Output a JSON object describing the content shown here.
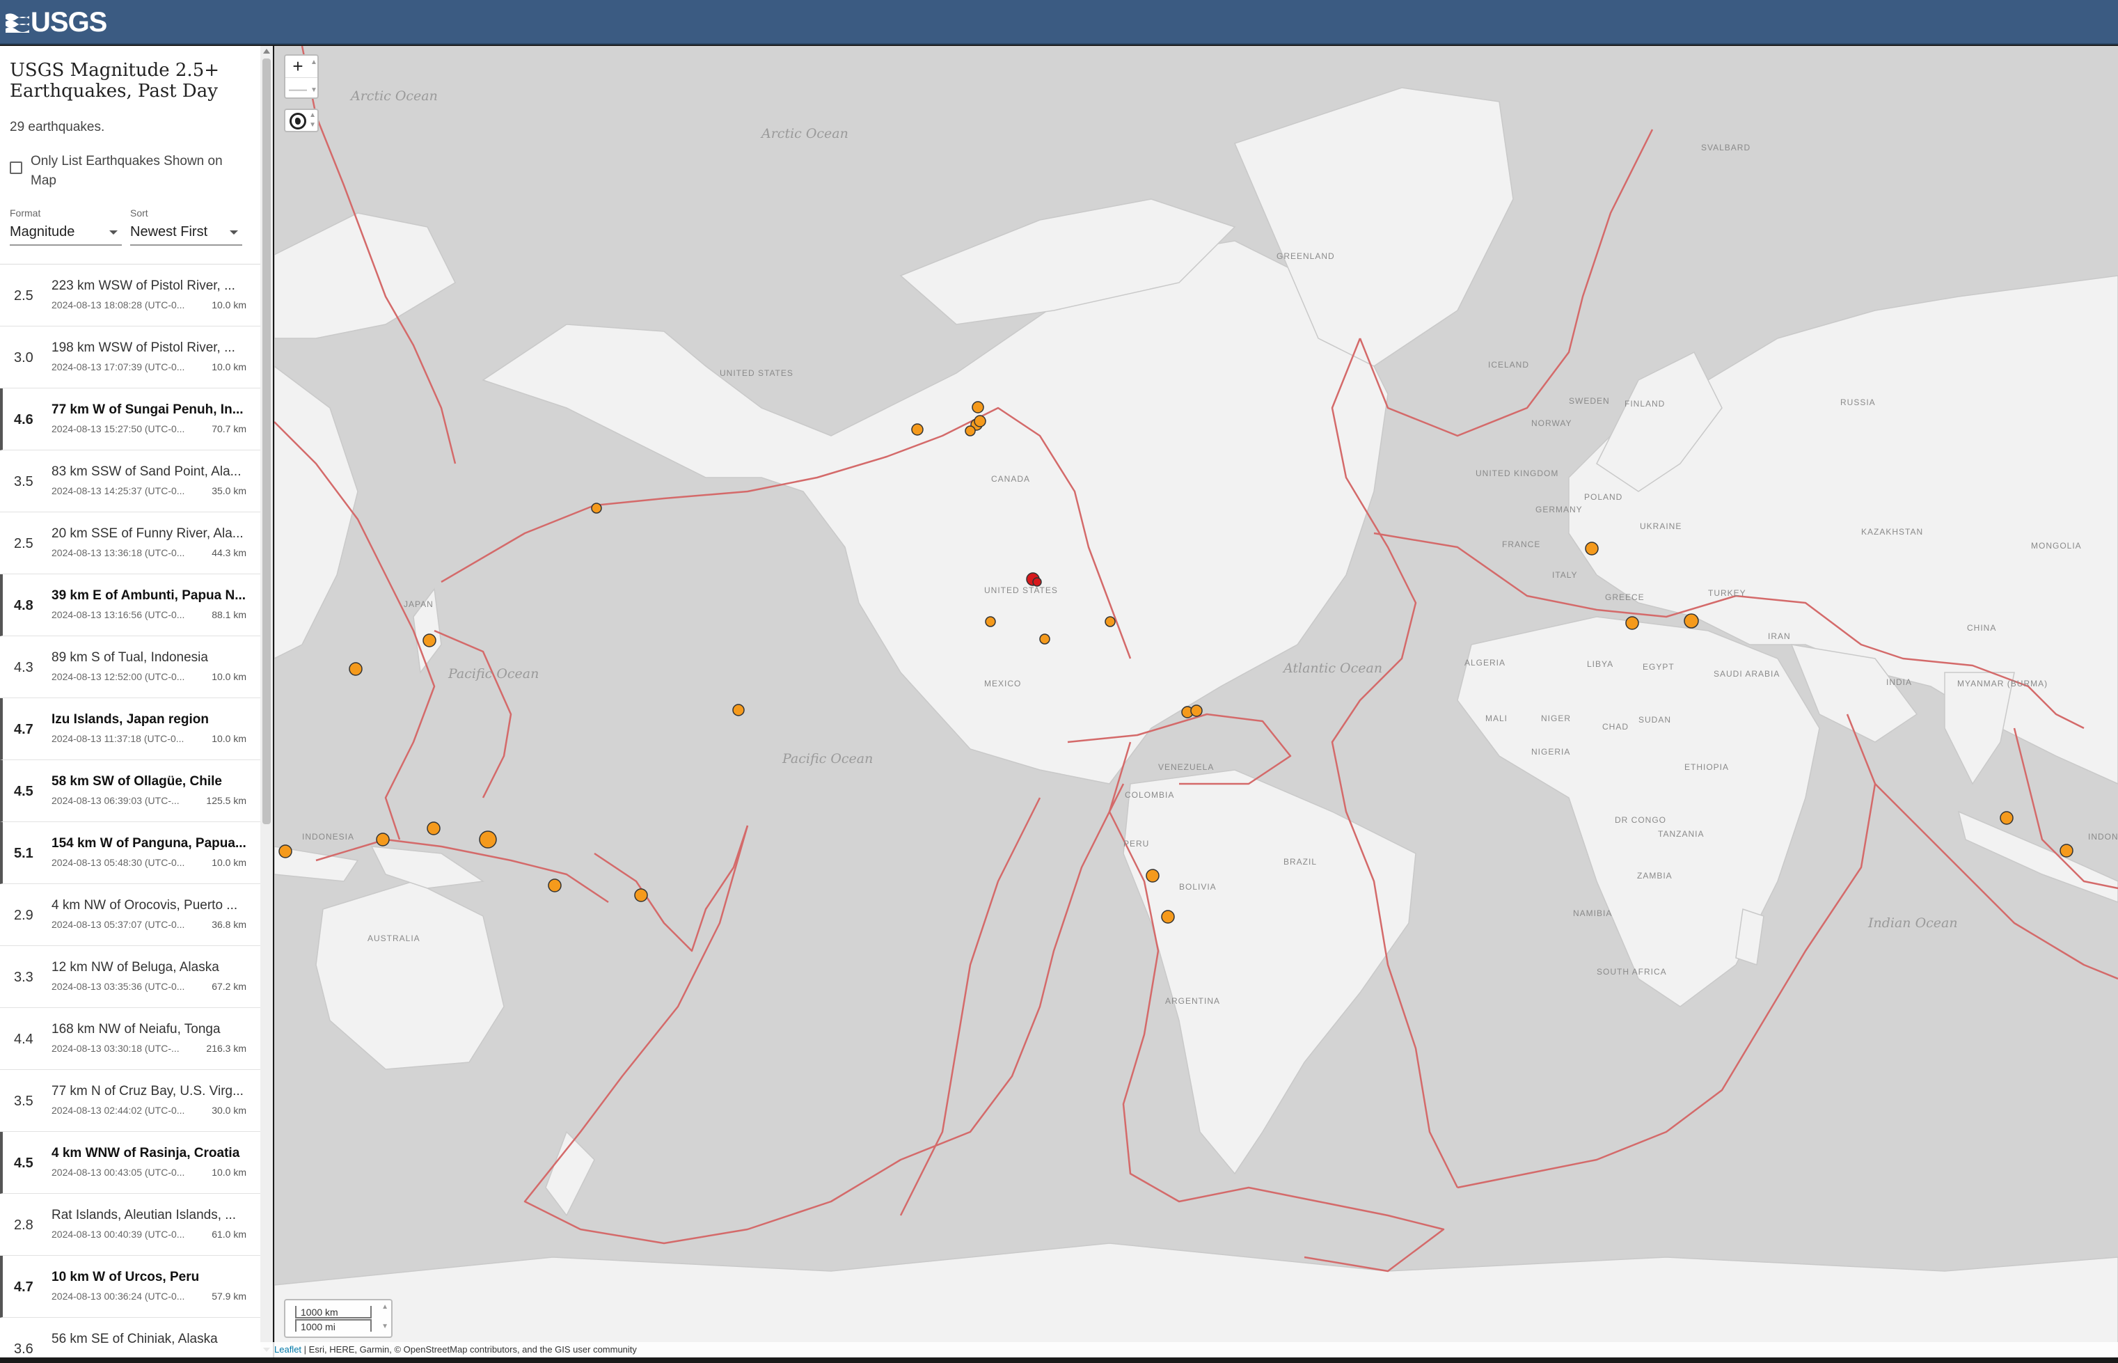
{
  "header": {
    "logo_text": "USGS"
  },
  "sidebar": {
    "title": "USGS Magnitude 2.5+ Earthquakes, Past Day",
    "count_text": "29 earthquakes.",
    "only_list_label": "Only List Earthquakes Shown on Map",
    "format": {
      "label": "Format",
      "value": "Magnitude"
    },
    "sort": {
      "label": "Sort",
      "value": "Newest First"
    }
  },
  "earthquakes": [
    {
      "mag": "2.5",
      "place": "223 km WSW of Pistol River, ...",
      "time": "2024-08-13 18:08:28 (UTC-0...",
      "depth": "10.0 km",
      "bold": false
    },
    {
      "mag": "3.0",
      "place": "198 km WSW of Pistol River, ...",
      "time": "2024-08-13 17:07:39 (UTC-0...",
      "depth": "10.0 km",
      "bold": false
    },
    {
      "mag": "4.6",
      "place": "77 km W of Sungai Penuh, In...",
      "time": "2024-08-13 15:27:50 (UTC-0...",
      "depth": "70.7 km",
      "bold": true
    },
    {
      "mag": "3.5",
      "place": "83 km SSW of Sand Point, Ala...",
      "time": "2024-08-13 14:25:37 (UTC-0...",
      "depth": "35.0 km",
      "bold": false
    },
    {
      "mag": "2.5",
      "place": "20 km SSE of Funny River, Ala...",
      "time": "2024-08-13 13:36:18 (UTC-0...",
      "depth": "44.3 km",
      "bold": false
    },
    {
      "mag": "4.8",
      "place": "39 km E of Ambunti, Papua N...",
      "time": "2024-08-13 13:16:56 (UTC-0...",
      "depth": "88.1 km",
      "bold": true
    },
    {
      "mag": "4.3",
      "place": "89 km S of Tual, Indonesia",
      "time": "2024-08-13 12:52:00 (UTC-0...",
      "depth": "10.0 km",
      "bold": false
    },
    {
      "mag": "4.7",
      "place": "Izu Islands, Japan region",
      "time": "2024-08-13 11:37:18 (UTC-0...",
      "depth": "10.0 km",
      "bold": true
    },
    {
      "mag": "4.5",
      "place": "58 km SW of Ollagüe, Chile",
      "time": "2024-08-13 06:39:03 (UTC-...",
      "depth": "125.5 km",
      "bold": true
    },
    {
      "mag": "5.1",
      "place": "154 km W of Panguna, Papua...",
      "time": "2024-08-13 05:48:30 (UTC-0...",
      "depth": "10.0 km",
      "bold": true
    },
    {
      "mag": "2.9",
      "place": "4 km NW of Orocovis, Puerto ...",
      "time": "2024-08-13 05:37:07 (UTC-0...",
      "depth": "36.8 km",
      "bold": false
    },
    {
      "mag": "3.3",
      "place": "12 km NW of Beluga, Alaska",
      "time": "2024-08-13 03:35:36 (UTC-0...",
      "depth": "67.2 km",
      "bold": false
    },
    {
      "mag": "4.4",
      "place": "168 km NW of Neiafu, Tonga",
      "time": "2024-08-13 03:30:18 (UTC-...",
      "depth": "216.3 km",
      "bold": false
    },
    {
      "mag": "3.5",
      "place": "77 km N of Cruz Bay, U.S. Virg...",
      "time": "2024-08-13 02:44:02 (UTC-0...",
      "depth": "30.0 km",
      "bold": false
    },
    {
      "mag": "4.5",
      "place": "4 km WNW of Rasinja, Croatia",
      "time": "2024-08-13 00:43:05 (UTC-0...",
      "depth": "10.0 km",
      "bold": true
    },
    {
      "mag": "2.8",
      "place": "Rat Islands, Aleutian Islands, ...",
      "time": "2024-08-13 00:40:39 (UTC-0...",
      "depth": "61.0 km",
      "bold": false
    },
    {
      "mag": "4.7",
      "place": "10 km W of Urcos, Peru",
      "time": "2024-08-13 00:36:24 (UTC-0...",
      "depth": "57.9 km",
      "bold": true
    },
    {
      "mag": "3.6",
      "place": "56 km SE of Chiniak, Alaska",
      "time": "",
      "depth": "",
      "bold": false
    }
  ],
  "map": {
    "zoom_in": "+",
    "zoom_out": "—",
    "scale_km": "1000 km",
    "scale_mi": "1000 mi",
    "attribution_leaflet": "Leaflet",
    "attribution_rest": "| Esri, HERE, Garmin, © OpenStreetMap contributors, and the GIS user community",
    "colors": {
      "land": "#f2f2f2",
      "ocean": "#d3d3d3",
      "plate_boundary": "#d46a6a",
      "quake": "#f59a1c",
      "quake_recent": "#d7191c"
    },
    "labels": {
      "oceans": [
        "Arctic Ocean",
        "Arctic Ocean",
        "Pacific Ocean",
        "Pacific Ocean",
        "Atlantic Ocean",
        "Indian Ocean"
      ],
      "countries": [
        "GREENLAND",
        "SVALBARD",
        "UNITED STATES",
        "CANADA",
        "UNITED STATES",
        "MEXICO",
        "VENEZUELA",
        "COLOMBIA",
        "PERU",
        "BOLIVIA",
        "BRAZIL",
        "ARGENTINA",
        "ICELAND",
        "SWEDEN",
        "FINLAND",
        "NORWAY",
        "UNITED KINGDOM",
        "POLAND",
        "GERMANY",
        "UKRAINE",
        "FRANCE",
        "ITALY",
        "GREECE",
        "TURKEY",
        "RUSSIA",
        "KAZAKHSTAN",
        "MONGOLIA",
        "CHINA",
        "IRAN",
        "INDIA",
        "MYANMAR (BURMA)",
        "SAUDI ARABIA",
        "EGYPT",
        "LIBYA",
        "ALGERIA",
        "MALI",
        "NIGER",
        "CHAD",
        "SUDAN",
        "NIGERIA",
        "ETHIOPIA",
        "DR CONGO",
        "TANZANIA",
        "ZAMBIA",
        "NAMIBIA",
        "SOUTH AFRICA",
        "JAPAN",
        "INDONESIA",
        "AUSTRALIA",
        "INDONES"
      ]
    }
  }
}
